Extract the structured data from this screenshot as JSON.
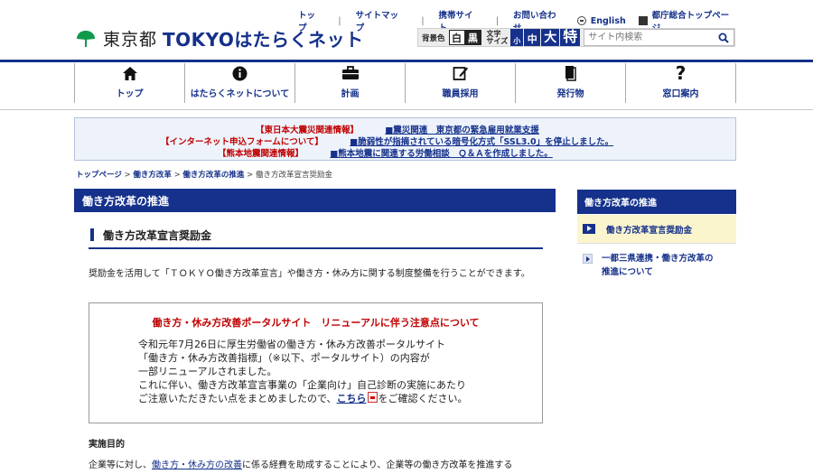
{
  "utility": {
    "top": "トップ",
    "sitemap": "サイトマップ",
    "mobile": "携帯サイト",
    "contact": "お問い合わせ",
    "english": "English",
    "metro_top": "都庁総合トップページ"
  },
  "logo": {
    "gov": "東京都",
    "name": "TOKYOはたらくネット"
  },
  "tools": {
    "bg_label": "背景色",
    "bg_white": "白",
    "bg_black": "黒",
    "size_label_1": "文字",
    "size_label_2": "サイズ",
    "size_small": "小",
    "size_medium": "中",
    "size_large": "大",
    "size_extra": "特",
    "search_placeholder": "サイト内検索"
  },
  "nav": [
    {
      "icon": "home-icon",
      "label": "トップ"
    },
    {
      "icon": "info-icon",
      "label": "はたらくネットについて"
    },
    {
      "icon": "briefcase-icon",
      "label": "計画"
    },
    {
      "icon": "edit-icon",
      "label": "職員採用"
    },
    {
      "icon": "book-icon",
      "label": "発行物"
    },
    {
      "icon": "question-icon",
      "label": "窓口案内"
    }
  ],
  "notices": [
    {
      "category": "【東日本大震災関連情報】",
      "link": "■震災関連　東京都の緊急雇用就業支援"
    },
    {
      "category": "【インターネット申込フォームについて】",
      "link": "■脆弱性が指摘されている暗号化方式「SSL3.0」を停止しました。"
    },
    {
      "category": "【熊本地震関連情報】",
      "link": "■熊本地震に関連する労働相談　Ｑ＆Ａを作成しました。"
    }
  ],
  "breadcrumb": {
    "home": "トップページ",
    "l1": "働き方改革",
    "l2": "働き方改革の推進",
    "current": "働き方改革宣言奨励金",
    "sep": ">"
  },
  "main": {
    "heading": "働き方改革の推進",
    "subheading": "働き方改革宣言奨励金",
    "intro": "奨励金を活用して「ＴＯＫＹＯ働き方改革宣言」や働き方・休み方に関する制度整備を行うことができます。",
    "box_title": "働き方・休み方改善ポータルサイト　リニューアルに伴う注意点について",
    "box_line1": "令和元年7月26日に厚生労働省の働き方・休み方改善ポータルサイト",
    "box_line2": "「働き方・休み方改善指標」（※以下、ポータルサイト）の内容が",
    "box_line3": "一部リニューアルされました。",
    "box_line4": "これに伴い、働き方改革宣言事業の「企業向け」自己診断の実施にあたり",
    "box_line5_pre": "ご注意いただきたい点をまとめましたので、",
    "box_link": "こちら",
    "box_line5_post": "をご確認ください。",
    "section_head": "実施目的",
    "section_pre": "企業等に対し、",
    "section_link": "働き方・休み方の改善",
    "section_post": "に係る経費を助成することにより、企業等の働き方改革を推進する"
  },
  "side": {
    "heading": "働き方改革の推進",
    "item1": "働き方改革宣言奨励金",
    "item2_l1": "一都三県連携・働き方改革の",
    "item2_l2": "推進について"
  },
  "colors": {
    "brand": "#15318b",
    "alert": "#c00000",
    "highlight": "#fbf5cd"
  }
}
